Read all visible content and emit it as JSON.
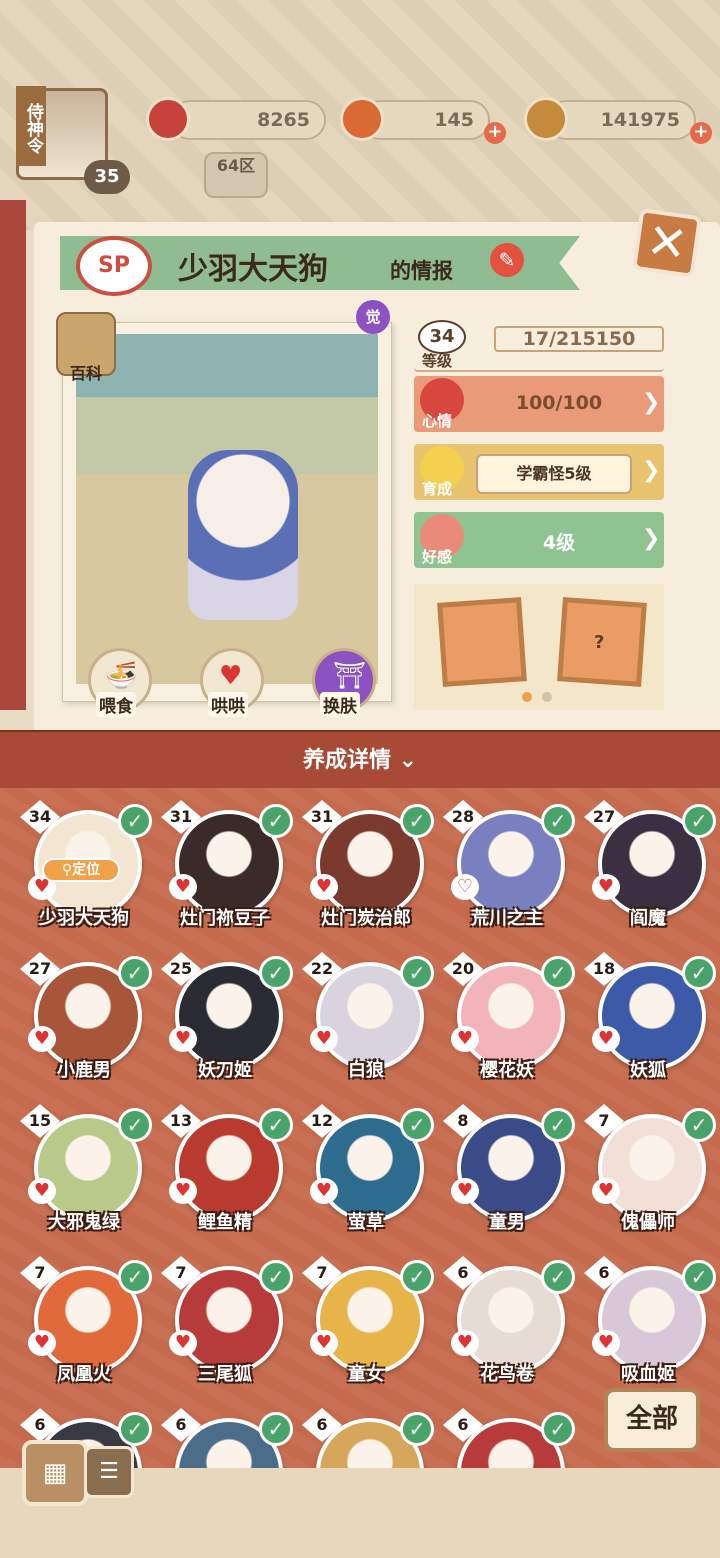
{
  "header": {
    "player_title": "侍神令",
    "player_level": "35",
    "zone": "64区",
    "resources": [
      {
        "name": "plum-blossom-currency",
        "value": "8265"
      },
      {
        "name": "soul-jade-currency",
        "value": "145",
        "has_plus": true
      },
      {
        "name": "gold-coin-currency",
        "value": "141975",
        "has_plus": true
      }
    ]
  },
  "profile": {
    "rarity": "SP",
    "name": "少羽大天狗",
    "name_suffix": "的情报",
    "awakened_badge": "觉",
    "wiki_label": "百科",
    "actions": [
      {
        "label": "喂食",
        "icon": "ramen-bowl-icon"
      },
      {
        "label": "哄哄",
        "icon": "milk-carton-icon"
      },
      {
        "label": "换肤",
        "icon": "kimono-icon"
      }
    ],
    "level": {
      "label": "等级",
      "value": "34",
      "exp": "17/215150"
    },
    "mood": {
      "label": "心情",
      "value": "100/100",
      "color": "#e99a79"
    },
    "growth": {
      "label": "育成",
      "value": "学霸怪5级",
      "color": "#e9c470"
    },
    "affinity": {
      "label": "好感",
      "value": "4级",
      "color": "#8fc490"
    },
    "pager": {
      "pages": 2,
      "current": 1
    }
  },
  "section": {
    "title": "养成详情",
    "expand_icon": "double-chevron-down-icon"
  },
  "roster": [
    {
      "level": "34",
      "name": "少羽大天狗",
      "located": true,
      "locate_label": "定位",
      "color": "#f2e6d2"
    },
    {
      "level": "31",
      "name": "灶门祢豆子",
      "color": "#3b2a2a"
    },
    {
      "level": "31",
      "name": "灶门炭治郎",
      "color": "#7a3b2e"
    },
    {
      "level": "28",
      "name": "荒川之主",
      "color": "#7a7fbf",
      "heart_broken": true
    },
    {
      "level": "27",
      "name": "阎魔",
      "color": "#3a3042"
    },
    {
      "level": "27",
      "name": "小鹿男",
      "color": "#a8563a"
    },
    {
      "level": "25",
      "name": "妖刀姬",
      "color": "#2b2b33"
    },
    {
      "level": "22",
      "name": "白狼",
      "color": "#d9d3dd"
    },
    {
      "level": "20",
      "name": "樱花妖",
      "color": "#f2b4b8"
    },
    {
      "level": "18",
      "name": "妖狐",
      "color": "#3d5aa8"
    },
    {
      "level": "15",
      "name": "大邪鬼绿",
      "color": "#b8c98a"
    },
    {
      "level": "13",
      "name": "鲤鱼精",
      "color": "#b93a2f"
    },
    {
      "level": "12",
      "name": "萤草",
      "color": "#2d6c8f"
    },
    {
      "level": "8",
      "name": "童男",
      "color": "#3a4b88"
    },
    {
      "level": "7",
      "name": "傀儡师",
      "color": "#f2dfd6"
    },
    {
      "level": "7",
      "name": "凤凰火",
      "color": "#e06a3b"
    },
    {
      "level": "7",
      "name": "三尾狐",
      "color": "#b83b3b"
    },
    {
      "level": "7",
      "name": "童女",
      "color": "#e6b449"
    },
    {
      "level": "6",
      "name": "花鸟卷",
      "color": "#e7dcd3"
    },
    {
      "level": "6",
      "name": "吸血姬",
      "color": "#d8c7d6"
    },
    {
      "level": "6",
      "name": "",
      "color": "#3a3a44"
    },
    {
      "level": "6",
      "name": "",
      "color": "#4b6d8a"
    },
    {
      "level": "6",
      "name": "",
      "color": "#d6a75a"
    },
    {
      "level": "6",
      "name": "",
      "color": "#b83b3b"
    }
  ],
  "footer": {
    "filter_label": "全部",
    "view_grid_icon": "grid-view-icon",
    "view_list_icon": "list-view-icon"
  }
}
